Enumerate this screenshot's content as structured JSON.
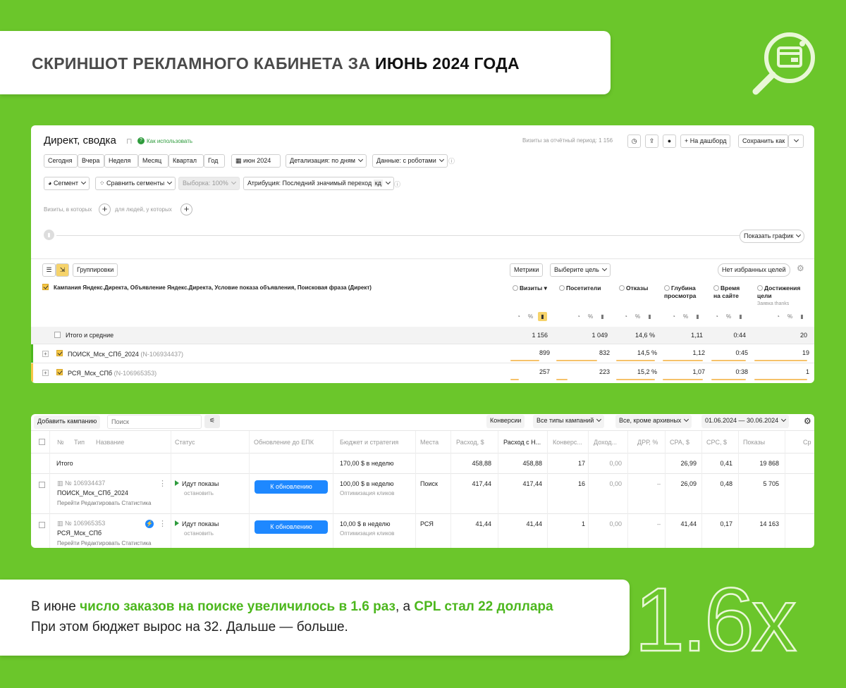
{
  "header": {
    "title_part1": "СКРИНШОТ РЕКЛАМНОГО КАБИНЕТА ЗА",
    "title_part2": "ИЮНЬ 2024 ГОДА"
  },
  "colors": {
    "background": "#6bc62b",
    "accent_text": "#4cb71d",
    "accent_yellow": "#f6c744",
    "button_blue": "#1e88ff"
  },
  "summary": {
    "title": "Директ, сводка",
    "how_to": "Как использовать",
    "visits_period": "Визиты за отчётный период: 1 156",
    "to_dashboard": "На дашборд",
    "save_as": "Сохранить как",
    "periods": [
      "Сегодня",
      "Вчера",
      "Неделя",
      "Месяц",
      "Квартал",
      "Год"
    ],
    "month": "июн 2024",
    "detail": "Детализация: по дням",
    "data": "Данные: с роботами",
    "segment": "Сегмент",
    "compare": "Сравнить сегменты",
    "sample": "Выборка: 100%",
    "attribution": "Атрибуция: Последний значимый переход",
    "attribution_badge": "кд",
    "visits_which": "Визиты, в которых",
    "for_people": "для людей, у которых",
    "show_chart": "Показать график",
    "groupings": "Группировки",
    "metrics": "Метрики",
    "choose_goal": "Выберите цель",
    "no_fav": "Нет избранных целей",
    "dim_header": "Кампания Яндекс.Директа, Объявление Яндекс.Директа, Условие показа объявления, Поисковая фраза (Директ)",
    "columns": [
      {
        "label": "Визиты",
        "sorted": "▾"
      },
      {
        "label": "Посетители"
      },
      {
        "label": "Отказы"
      },
      {
        "label": "Глубина просмотра"
      },
      {
        "label": "Время на сайте"
      },
      {
        "label": "Достижения цели",
        "sub": "Заявка thanks"
      }
    ],
    "total_label": "Итого и средние",
    "total": [
      "1 156",
      "1 049",
      "14,6 %",
      "1,11",
      "0:44",
      "20"
    ],
    "rows": [
      {
        "name": "ПОИСК_Мск_СПб_2024",
        "id": "(N-106934437)",
        "values": [
          "899",
          "832",
          "14,5 %",
          "1,12",
          "0:45",
          "19"
        ]
      },
      {
        "name": "РСЯ_Мск_СПб",
        "id": "(N-106965353)",
        "values": [
          "257",
          "223",
          "15,2 %",
          "1,07",
          "0:38",
          "1"
        ]
      }
    ]
  },
  "campaigns": {
    "add": "Добавить кампанию",
    "search_placeholder": "Поиск",
    "conversion": "Конверсии",
    "types": "Все типы кампаний",
    "archive": "Все, кроме архивных",
    "dates": "01.06.2024 — 30.06.2024",
    "headers": [
      "№",
      "Тип",
      "Название",
      "Статус",
      "Обновление до ЕПК",
      "Бюджет и стратегия",
      "Места",
      "Расход, $",
      "Расход с Н...",
      "Конверс...",
      "Доход...",
      "ДРР, %",
      "CPA, $",
      "CPC, $",
      "Показы",
      "Ср"
    ],
    "total": {
      "label": "Итого",
      "budget": "170,00 $ в неделю",
      "spend": "458,88",
      "spend_nds": "458,88",
      "conv": "17",
      "income": "0,00",
      "cpa": "26,99",
      "cpc": "0,41",
      "shows": "19 868"
    },
    "rows": [
      {
        "id": "№ 106934437",
        "name": "ПОИСК_Мск_СПб_2024",
        "actions": [
          "Перейти",
          "Редактировать",
          "Статистика"
        ],
        "status": "Идут показы",
        "stop": "остановить",
        "update": "К обновлению",
        "budget": "100,00 $ в неделю",
        "strategy": "Оптимизация кликов",
        "place": "Поиск",
        "spend": "417,44",
        "spend_nds": "417,44",
        "conv": "16",
        "income": "0,00",
        "drr": "–",
        "cpa": "26,09",
        "cpc": "0,48",
        "shows": "5 705"
      },
      {
        "id": "№ 106965353",
        "name": "РСЯ_Мск_СПб",
        "actions": [
          "Перейти",
          "Редактировать",
          "Статистика"
        ],
        "status": "Идут показы",
        "stop": "остановить",
        "update": "К обновлению",
        "budget": "10,00 $ в неделю",
        "strategy": "Оптимизация кликов",
        "place": "РСЯ",
        "spend": "41,44",
        "spend_nds": "41,44",
        "conv": "1",
        "income": "0,00",
        "drr": "–",
        "cpa": "41,44",
        "cpc": "0,17",
        "shows": "14 163"
      }
    ]
  },
  "footer": {
    "l1_a": "В июне ",
    "l1_b": "число заказов на поиске увеличилось в 1.6 раз",
    "l1_c": ", а ",
    "l1_d": "CPL стал 22 доллара",
    ".": ".",
    "l2": "При этом бюджет вырос на 32. Дальше — больше.",
    "big": "1.6x"
  }
}
